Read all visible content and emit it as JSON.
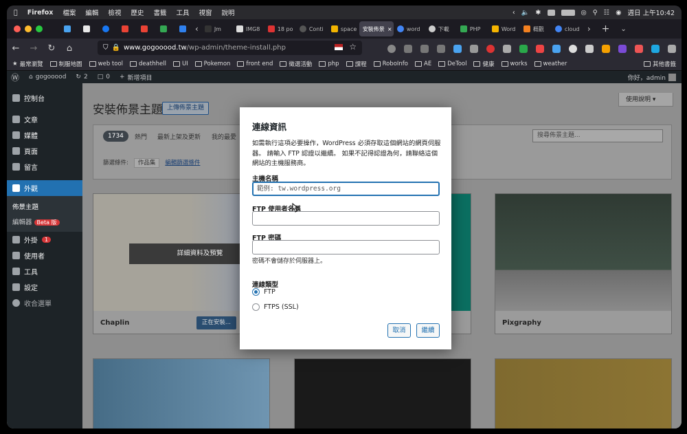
{
  "menubar": {
    "app": "Firefox",
    "items": [
      "檔案",
      "編輯",
      "檢視",
      "歷史",
      "書籤",
      "工具",
      "視窗",
      "說明"
    ],
    "clock": "週日 上午10:42"
  },
  "tabs": [
    {
      "label": "",
      "type": "pin"
    },
    {
      "label": "",
      "type": "pin"
    },
    {
      "label": "",
      "type": "pin"
    },
    {
      "label": "",
      "type": "pin"
    },
    {
      "label": "",
      "type": "pin"
    },
    {
      "label": "",
      "type": "pin"
    },
    {
      "label": "",
      "type": "pin"
    },
    {
      "label": "Jm",
      "type": "norm"
    },
    {
      "label": "IMG8",
      "type": "norm"
    },
    {
      "label": "18 po",
      "type": "norm"
    },
    {
      "label": "Conti",
      "type": "norm"
    },
    {
      "label": "space",
      "type": "norm"
    },
    {
      "label": "安裝佈景",
      "type": "active"
    },
    {
      "label": "word",
      "type": "norm"
    },
    {
      "label": "下載",
      "type": "norm"
    },
    {
      "label": "PHP",
      "type": "norm"
    },
    {
      "label": "Word",
      "type": "norm"
    },
    {
      "label": "概觀",
      "type": "norm"
    },
    {
      "label": "cloud",
      "type": "norm"
    }
  ],
  "url": {
    "host": "www.gogooood.tw",
    "path": "/wp-admin/theme-install.php"
  },
  "bookmarks": [
    "最常瀏覽",
    "制服地圖",
    "web tool",
    "deathhell",
    "UI",
    "Pokemon",
    "front end",
    "徵選活動",
    "php",
    "課程",
    "RoboInfo",
    "AE",
    "DeTool",
    "健康",
    "works",
    "weather"
  ],
  "bookmarks_other": "其他書籤",
  "wpbar": {
    "site": "gogooood",
    "updates": "2",
    "comments": "0",
    "new": "新增項目",
    "greeting": "你好，admin"
  },
  "sidebar": {
    "dashboard": "控制台",
    "posts": "文章",
    "media": "媒體",
    "pages": "頁面",
    "comments": "留言",
    "appearance": "外觀",
    "themes": "佈景主題",
    "editor": "編輯器",
    "beta": "Beta 版",
    "plugins": "外掛",
    "plugins_count": "1",
    "users": "使用者",
    "tools": "工具",
    "settings": "設定",
    "collapse": "收合選單"
  },
  "main": {
    "title": "安裝佈景主題",
    "upload": "上傳佈景主題",
    "help": "使用說明 ▾",
    "count": "1734",
    "filters": [
      "熱門",
      "最新上架及更新",
      "我的最愛"
    ],
    "search_placeholder": "搜尋佈景主題...",
    "filter_label": "篩選條件:",
    "filter_chip": "作品集",
    "filter_edit": "編輯篩選條件",
    "details_overlay": "詳細資料及預覽",
    "installing": "正在安裝..."
  },
  "themes": [
    {
      "name": "Chaplin"
    },
    {
      "name": ""
    },
    {
      "name": "Pixgraphy"
    }
  ],
  "modal": {
    "title": "連線資訊",
    "description": "如需執行這項必要操作，WordPress 必須存取這個網站的網頁伺服器。 請輸入 FTP 認證以繼續。 如果不記得認證為何，請聯絡這個網站的主機服務商。",
    "host_label": "主機名稱",
    "host_placeholder": "範例: tw.wordpress.org",
    "user_label": "FTP 使用者名稱",
    "pass_label": "FTP 密碼",
    "pass_note": "密碼不會儲存於伺服器上。",
    "conn_type_label": "連線類型",
    "opt_ftp": "FTP",
    "opt_ftps": "FTPS (SSL)",
    "cancel": "取消",
    "proceed": "繼續"
  },
  "colors": {
    "accent": "#2271b1",
    "wpbar": "#1d2327",
    "modal_bg": "#ffffff"
  }
}
